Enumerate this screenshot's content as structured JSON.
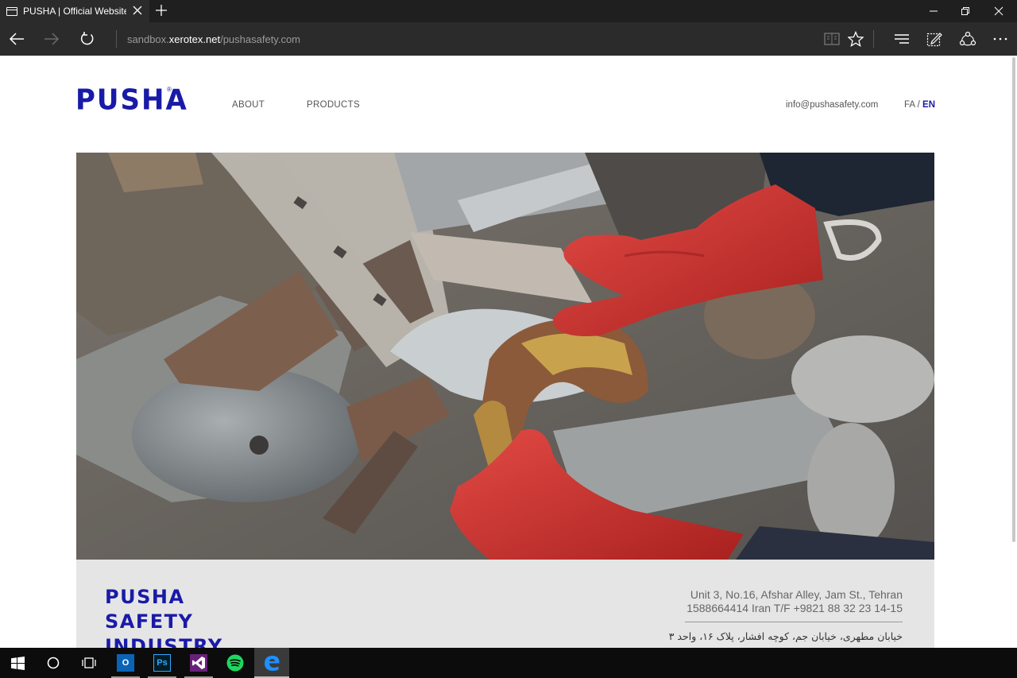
{
  "browser": {
    "tab_title": "PUSHA | Official Website",
    "url_prefix": "sandbox.",
    "url_domain": "xerotex.net",
    "url_suffix": "/pushasafety.com"
  },
  "site": {
    "logo_text": "PUSHA",
    "logo_reg": "®",
    "nav": {
      "about": "ABOUT",
      "products": "PRODUCTS"
    },
    "email": "info@pushasafety.com",
    "lang": {
      "fa": "FA",
      "separator": " / ",
      "en": "EN"
    },
    "footer": {
      "logo_lines": [
        "PUSHA",
        "SAFETY",
        "INDUSTRY"
      ],
      "address_en_line1": "Unit 3, No.16, Afshar Alley, Jam St., Tehran",
      "address_en_line2": "1588664414 Iran T/F +9821 88 32 23 14-15",
      "address_fa_line1": "خیابان مطهری، خیابان جم، کوچه افشار، پلاک ۱۶، واحد ۳"
    }
  },
  "taskbar": {
    "icons": [
      "windows-start-icon",
      "cortana-icon",
      "task-view-icon",
      "outlook-icon",
      "photoshop-icon",
      "visual-studio-icon",
      "spotify-icon",
      "edge-icon"
    ],
    "photoshop_label": "Ps",
    "outlook_label": "O"
  },
  "colors": {
    "brand_blue": "#1a1aa8",
    "chrome_dark": "#2b2b2b",
    "footer_band": "#e5e5e5"
  }
}
